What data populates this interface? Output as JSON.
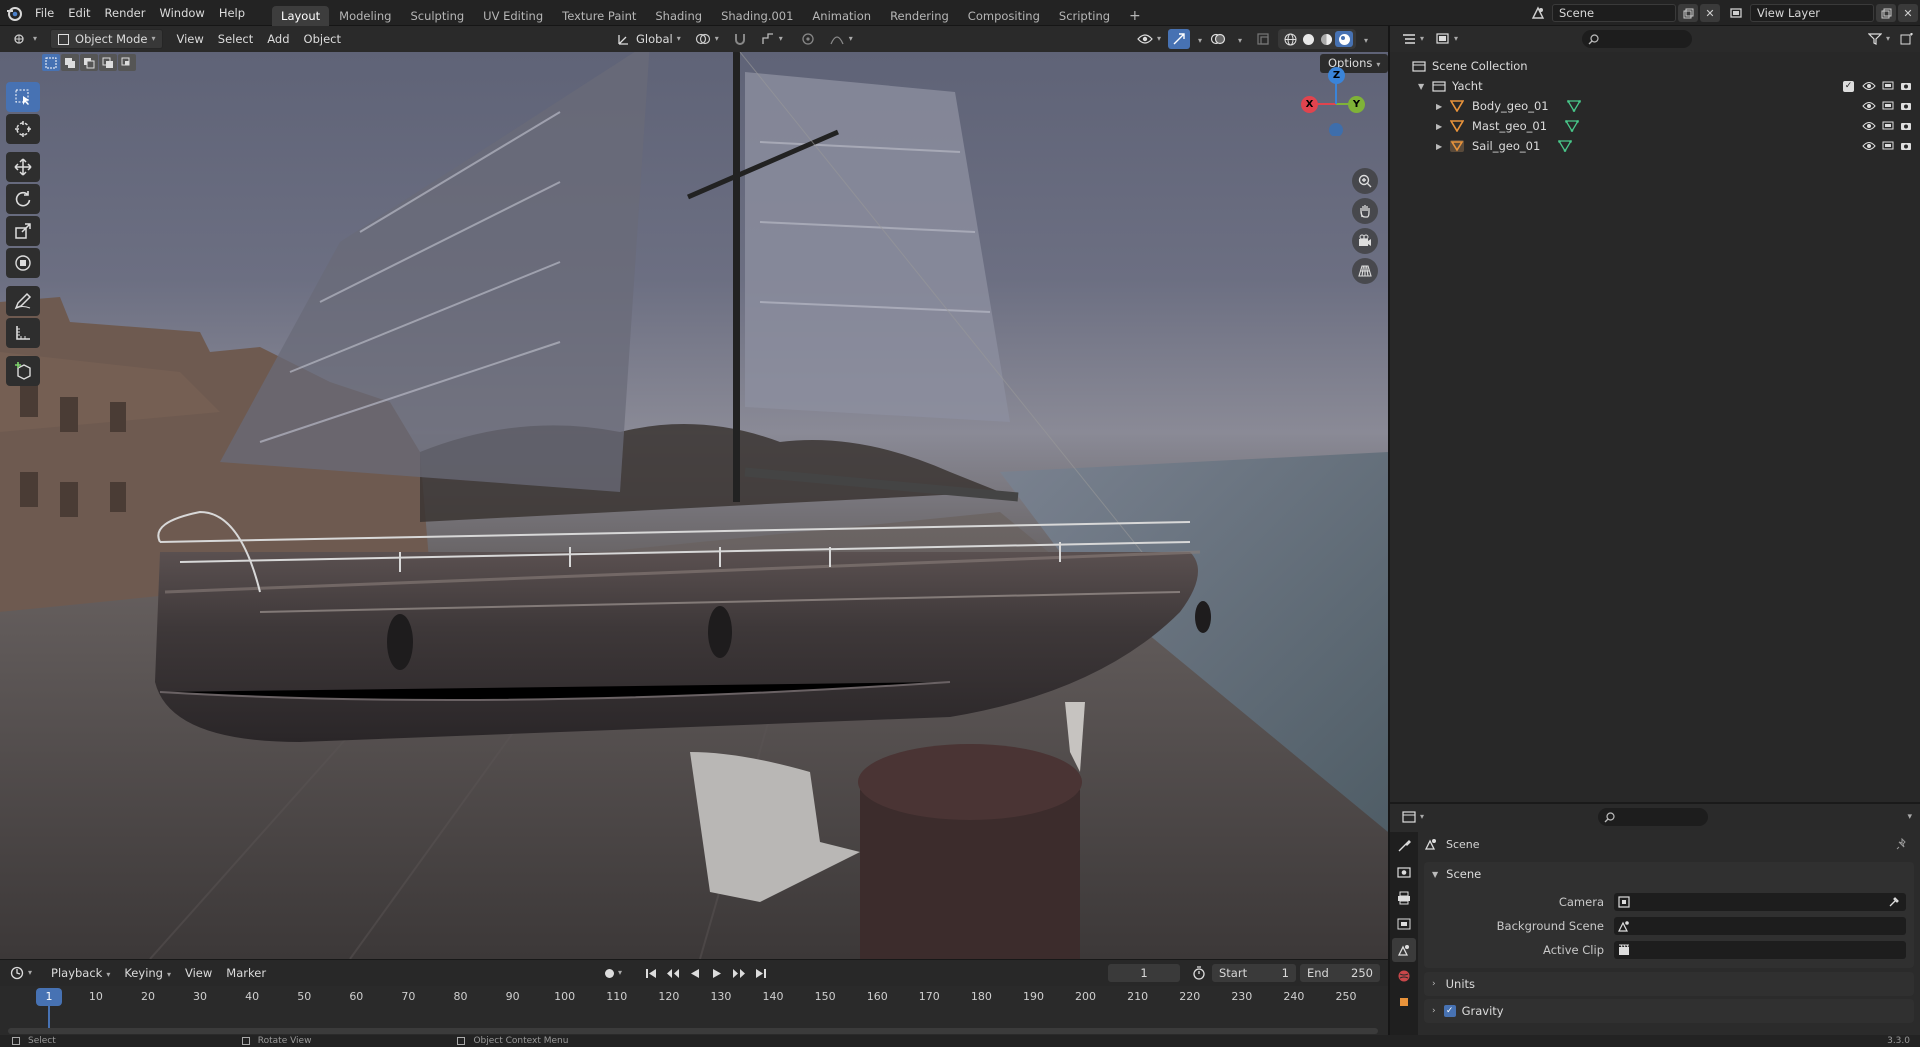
{
  "menubar": {
    "items": [
      "File",
      "Edit",
      "Render",
      "Window",
      "Help"
    ],
    "workspaces": [
      "Layout",
      "Modeling",
      "Sculpting",
      "UV Editing",
      "Texture Paint",
      "Shading",
      "Shading.001",
      "Animation",
      "Rendering",
      "Compositing",
      "Scripting"
    ],
    "active_workspace": "Layout",
    "add_tab": "+",
    "scene_name": "Scene",
    "view_layer_name": "View Layer"
  },
  "viewport_header": {
    "mode": "Object Mode",
    "menus": [
      "View",
      "Select",
      "Add",
      "Object"
    ],
    "transform_orientation": "Global",
    "options_label": "Options"
  },
  "gizmo": {
    "x": "X",
    "y": "Y",
    "z": "Z"
  },
  "outliner": {
    "root": "Scene Collection",
    "collection": "Yacht",
    "objects": [
      {
        "name": "Body_geo_01"
      },
      {
        "name": "Mast_geo_01"
      },
      {
        "name": "Sail_geo_01"
      }
    ]
  },
  "properties": {
    "context_name": "Scene",
    "panel_title": "Scene",
    "fields": [
      {
        "label": "Camera",
        "value": ""
      },
      {
        "label": "Background Scene",
        "value": ""
      },
      {
        "label": "Active Clip",
        "value": ""
      }
    ],
    "subpanels": [
      {
        "label": "Units",
        "checkbox": false
      },
      {
        "label": "Gravity",
        "checkbox": true
      }
    ]
  },
  "timeline": {
    "menus": [
      "Playback",
      "Keying",
      "View",
      "Marker"
    ],
    "current_frame": "1",
    "start_label": "Start",
    "start_value": "1",
    "end_label": "End",
    "end_value": "250",
    "ticks": [
      "1",
      "10",
      "20",
      "30",
      "40",
      "50",
      "60",
      "70",
      "80",
      "90",
      "100",
      "110",
      "120",
      "130",
      "140",
      "150",
      "160",
      "170",
      "180",
      "190",
      "200",
      "210",
      "220",
      "230",
      "240",
      "250"
    ]
  },
  "statusbar": {
    "items": [
      "Select",
      "Rotate View",
      "Object Context Menu"
    ],
    "version": "3.3.0"
  },
  "colors": {
    "accent": "#4772b3",
    "active_tab": "#3d3d3d",
    "x_axis": "#e0444e",
    "y_axis": "#7fb238",
    "z_axis": "#3a84d9",
    "mesh_icon": "#e8933b",
    "data_icon": "#49c78a"
  }
}
